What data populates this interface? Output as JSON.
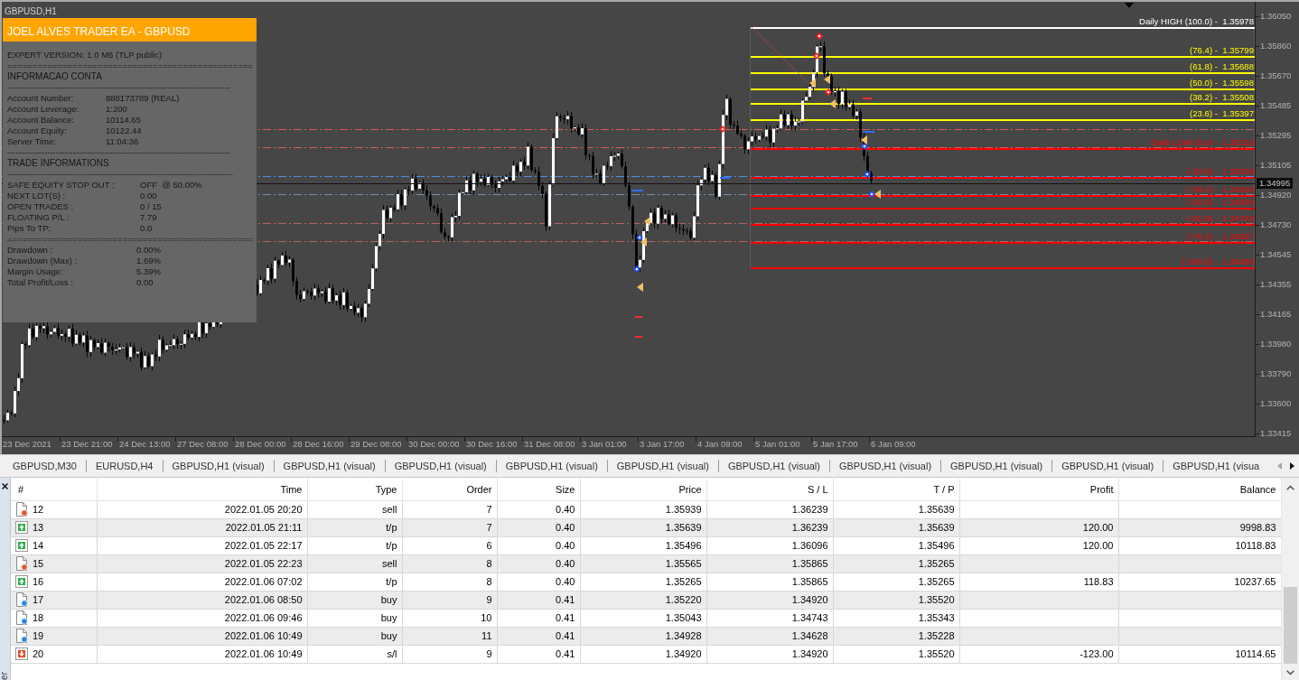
{
  "chart": {
    "title": "GBPUSD,H1",
    "info_panel": {
      "title": "JOEL ALVES TRADER EA - GBPUSD",
      "blocks": [
        {
          "kind": "text",
          "text": "EXPERT VERSION: 1.0 M6 (TLP public)"
        },
        {
          "kind": "rule",
          "text": "================================================="
        },
        {
          "kind": "heading",
          "text": "INFORMACAO CONTA"
        },
        {
          "kind": "rule",
          "text": "------------------------------------------------------------------------------"
        },
        {
          "kind": "fields",
          "rows": [
            {
              "label": "Account Number:",
              "value": "888173789 (REAL)"
            },
            {
              "label": "Account Leverage:",
              "value": "1:200"
            },
            {
              "label": "Account Balance:",
              "value": "10114.65"
            },
            {
              "label": "Account Equity:",
              "value": "10122.44"
            },
            {
              "label": "Server Time:",
              "value": "11:04:36"
            }
          ]
        },
        {
          "kind": "rule",
          "text": "------------------------------------------------------------------------------"
        },
        {
          "kind": "heading",
          "text": "TRADE INFORMATIONS"
        },
        {
          "kind": "rule",
          "text": "-------------------------------------------------------------------------------"
        },
        {
          "kind": "fields",
          "rows": [
            {
              "label": "SAFE EQUITY STOP OUT :",
              "value": "OFF  @ 50.00%"
            },
            {
              "label": "NEXT LOT(S) :",
              "value": "0.00"
            },
            {
              "label": "OPEN TRADES :",
              "value": "0 / 15"
            },
            {
              "label": "FLOATING P/L :",
              "value": "7.79"
            },
            {
              "label": "Pips To TP:",
              "value": "0.0"
            }
          ]
        },
        {
          "kind": "rule",
          "text": "================================================="
        },
        {
          "kind": "fields",
          "rows": [
            {
              "label": "Drawdown :",
              "value": "0.00%"
            },
            {
              "label": "Drawdown (Max) :",
              "value": "1.69%"
            },
            {
              "label": "Margin Usage:",
              "value": "5.39%"
            },
            {
              "label": "Total Profit/Loss :",
              "value": "0.00"
            }
          ]
        }
      ]
    },
    "fibonacci_levels": [
      {
        "label": "Daily HIGH (100.0) -  1.35978",
        "color": "#ffffff"
      },
      {
        "label": "(76.4) -  1.35799",
        "color": "#ffff00"
      },
      {
        "label": "(61.8) -  1.35688",
        "color": "#ffff00"
      },
      {
        "label": "(50.0) -  1.35598",
        "color": "#ffff00"
      },
      {
        "label": "(38.2) -  1.35508",
        "color": "#ffff00"
      },
      {
        "label": "(23.6) -  1.35397",
        "color": "#ffff00"
      },
      {
        "label": "Daily LOW (0.0) -  1.35218",
        "color": "#ff0000"
      },
      {
        "label": "(-23.6) -  1.35039",
        "color": "#ff0000"
      },
      {
        "label": "(-38.2) -  1.34928",
        "color": "#ff0000"
      },
      {
        "label": "(-50.0) -  1.34838",
        "color": "#ff0000"
      },
      {
        "label": "(-61.8) -  1.34748",
        "color": "#ff0000"
      },
      {
        "label": "(-76.4) -  1.34637",
        "color": "#ff0000"
      },
      {
        "label": "(-100.0) -  1.34458",
        "color": "#ff0000"
      }
    ],
    "price_axis": [
      "1.36050",
      "1.35860",
      "1.35670",
      "1.35485",
      "1.35295",
      "1.35105",
      "1.34920",
      "1.34730",
      "1.34545",
      "1.34355",
      "1.34165",
      "1.33980",
      "1.33790",
      "1.33600",
      "1.33415"
    ],
    "current_price": "1.34995",
    "time_axis": [
      "23 Dec 2021",
      "23 Dec 21:00",
      "24 Dec 13:00",
      "27 Dec 08:00",
      "28 Dec 00:00",
      "28 Dec 16:00",
      "29 Dec 08:00",
      "30 Dec 00:00",
      "30 Dec 16:00",
      "31 Dec 08:00",
      "3 Jan 01:00",
      "3 Jan 17:00",
      "4 Jan 09:00",
      "5 Jan 01:00",
      "5 Jan 17:00",
      "6 Jan 09:00"
    ]
  },
  "tabs": [
    {
      "label": "GBPUSD,M30",
      "selected": false
    },
    {
      "label": "EURUSD,H4",
      "selected": false
    },
    {
      "label": "GBPUSD,H1 (visual)",
      "selected": false
    },
    {
      "label": "GBPUSD,H1 (visual)",
      "selected": false
    },
    {
      "label": "GBPUSD,H1 (visual)",
      "selected": false
    },
    {
      "label": "GBPUSD,H1 (visual)",
      "selected": false
    },
    {
      "label": "GBPUSD,H1 (visual)",
      "selected": false
    },
    {
      "label": "GBPUSD,H1 (visual)",
      "selected": false
    },
    {
      "label": "GBPUSD,H1 (visual)",
      "selected": false
    },
    {
      "label": "GBPUSD,H1 (visual)",
      "selected": false
    },
    {
      "label": "GBPUSD,H1 (visual)",
      "selected": false
    },
    {
      "label": "GBPUSD,H1 (visua",
      "selected": false
    }
  ],
  "tab_scroll_buttons": [
    {
      "kind": "left",
      "disabled": true
    },
    {
      "kind": "right",
      "disabled": false
    }
  ],
  "side_panel": {
    "label": "er"
  },
  "history_table": {
    "columns": [
      "#",
      "Time",
      "Type",
      "Order",
      "Size",
      "Price",
      "S / L",
      "T / P",
      "Profit",
      "Balance"
    ],
    "rows": [
      {
        "kind": "sell",
        "number": "12",
        "time": "2022.01.05 20:20",
        "type": "sell",
        "order": "7",
        "size": "0.40",
        "price": "1.35939",
        "sl": "1.36239",
        "tp": "1.35639"
      },
      {
        "kind": "take_profit",
        "number": "13",
        "time": "2022.01.05 21:11",
        "type": "t/p",
        "order": "7",
        "size": "0.40",
        "price": "1.35639",
        "sl": "1.36239",
        "tp": "1.35639",
        "profit": "120.00",
        "balance": "9998.83"
      },
      {
        "kind": "take_profit",
        "number": "14",
        "time": "2022.01.05 22:17",
        "type": "t/p",
        "order": "6",
        "size": "0.40",
        "price": "1.35496",
        "sl": "1.36096",
        "tp": "1.35496",
        "profit": "120.00",
        "balance": "10118.83"
      },
      {
        "kind": "sell",
        "number": "15",
        "time": "2022.01.05 22:23",
        "type": "sell",
        "order": "8",
        "size": "0.40",
        "price": "1.35565",
        "sl": "1.35865",
        "tp": "1.35265"
      },
      {
        "kind": "take_profit",
        "number": "16",
        "time": "2022.01.06 07:02",
        "type": "t/p",
        "order": "8",
        "size": "0.40",
        "price": "1.35265",
        "sl": "1.35865",
        "tp": "1.35265",
        "profit": "118.83",
        "balance": "10237.65"
      },
      {
        "kind": "buy",
        "number": "17",
        "time": "2022.01.06 08:50",
        "type": "buy",
        "order": "9",
        "size": "0.41",
        "price": "1.35220",
        "sl": "1.34920",
        "tp": "1.35520"
      },
      {
        "kind": "buy",
        "number": "18",
        "time": "2022.01.06 09:46",
        "type": "buy",
        "order": "10",
        "size": "0.41",
        "price": "1.35043",
        "sl": "1.34743",
        "tp": "1.35343"
      },
      {
        "kind": "buy",
        "number": "19",
        "time": "2022.01.06 10:49",
        "type": "buy",
        "order": "11",
        "size": "0.41",
        "price": "1.34928",
        "sl": "1.34628",
        "tp": "1.35228"
      },
      {
        "kind": "stop_loss",
        "number": "20",
        "time": "2022.01.06 10:49",
        "type": "s/l",
        "order": "9",
        "size": "0.41",
        "price": "1.34920",
        "sl": "1.34920",
        "tp": "1.35520",
        "profit": "-123.00",
        "balance": "10114.65"
      }
    ]
  }
}
